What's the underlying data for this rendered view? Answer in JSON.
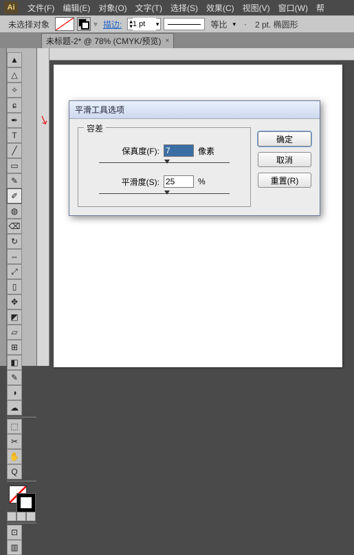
{
  "menubar": {
    "logo": "Ai",
    "items": [
      "文件(F)",
      "编辑(E)",
      "对象(O)",
      "文字(T)",
      "选择(S)",
      "效果(C)",
      "视图(V)",
      "窗口(W)",
      "帮"
    ]
  },
  "optionsbar": {
    "no_selection": "未选择对象",
    "stroke_label": "描边:",
    "stroke_weight": "1 pt",
    "proportion_label": "等比",
    "shape_info": "2 pt. 椭圆形"
  },
  "doctab": {
    "title": "未标题-2* @ 78% (CMYK/预览)",
    "close": "×"
  },
  "dialog": {
    "title": "平滑工具选项",
    "group_label": "容差",
    "fidelity_label": "保真度(F):",
    "fidelity_value": "7",
    "fidelity_unit": "像素",
    "smoothness_label": "平滑度(S):",
    "smoothness_value": "25",
    "smoothness_unit": "%",
    "ok": "确定",
    "cancel": "取消",
    "reset": "重置(R)"
  },
  "tools": {
    "list": [
      "▢",
      "▤",
      "✒",
      "T",
      "╱",
      "▭",
      "✎",
      "⌫",
      "↻",
      "⇔",
      "▱",
      "◐",
      "✂",
      "◳",
      "⊞",
      "✥",
      "◩",
      "⬚",
      "⌖",
      "⤢",
      "Q",
      "▥",
      "⊡",
      "✋"
    ]
  }
}
